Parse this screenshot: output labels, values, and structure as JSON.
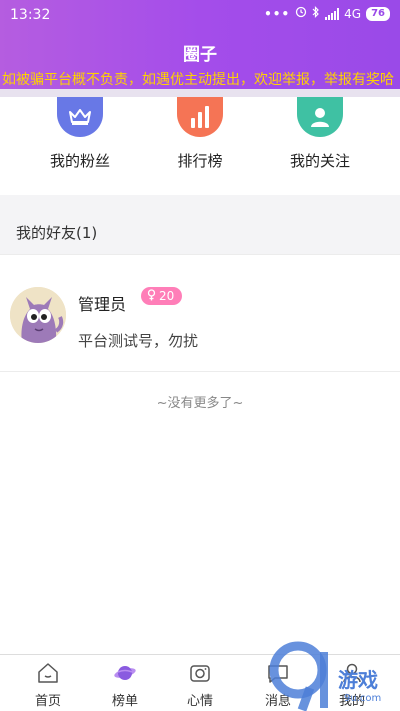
{
  "status_bar": {
    "time": "13:32",
    "network": "4G",
    "battery": "76"
  },
  "header": {
    "title": "圈子"
  },
  "notice": {
    "text": "如被骗平台概不负责，如遇优主动提出，欢迎举报，举报有奖哈"
  },
  "quick_actions": [
    {
      "label": "我的粉丝",
      "icon": "crown-icon",
      "color": "#6878e6"
    },
    {
      "label": "排行榜",
      "icon": "bar-chart-icon",
      "color": "#f57455"
    },
    {
      "label": "我的关注",
      "icon": "user-icon",
      "color": "#3fc1a3"
    }
  ],
  "friends": {
    "header": "我的好友(1)",
    "items": [
      {
        "name": "管理员",
        "badge": "20",
        "signature": "平台测试号，勿扰"
      }
    ],
    "no_more": "~没有更多了~"
  },
  "tabbar": [
    {
      "label": "首页",
      "icon": "home-icon"
    },
    {
      "label": "榜单",
      "icon": "planet-icon",
      "active": true
    },
    {
      "label": "心情",
      "icon": "camera-icon"
    },
    {
      "label": "消息",
      "icon": "message-icon"
    },
    {
      "label": "我的",
      "icon": "profile-icon"
    }
  ],
  "watermark": {
    "text": "游戏",
    "url": "9u.com"
  },
  "colors": {
    "header_start": "#b55de0",
    "header_end": "#9a4ae8",
    "notice_text": "#ffd200",
    "badge": "#ff7eb8"
  }
}
